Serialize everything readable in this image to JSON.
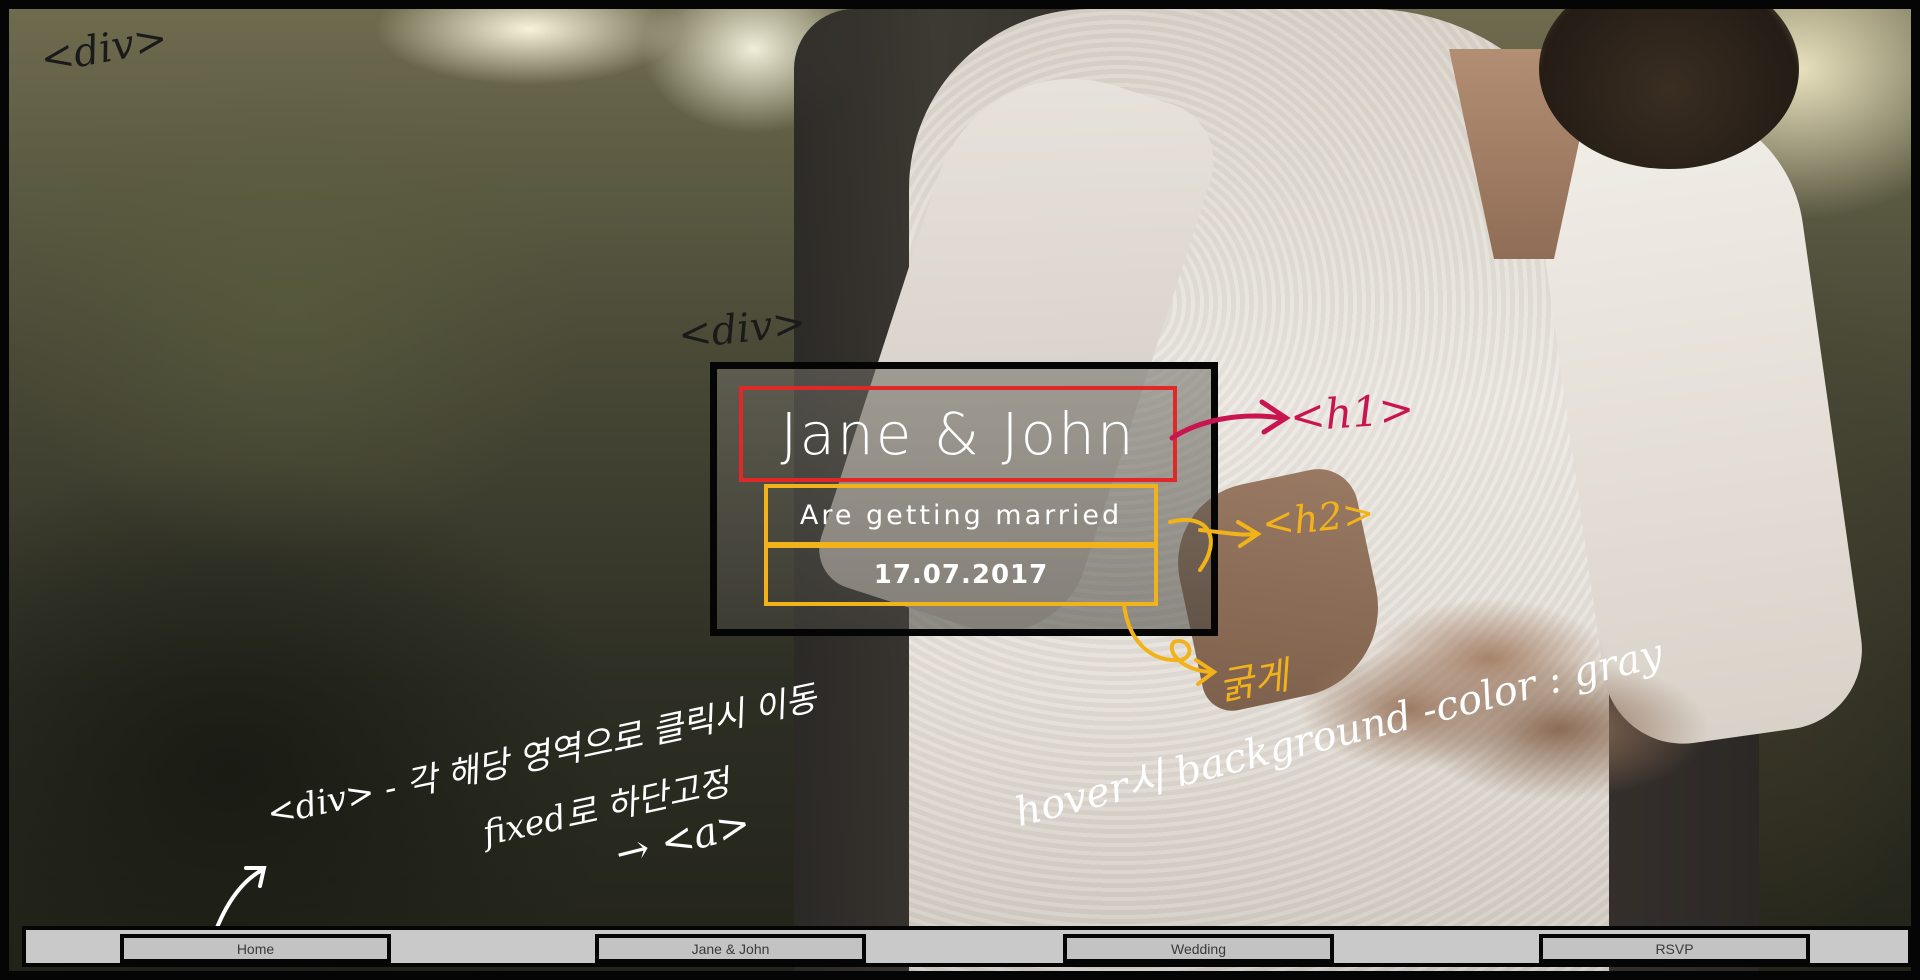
{
  "hero": {
    "title": "Jane & John",
    "subtitle": "Are getting married",
    "date": "17.07.2017"
  },
  "nav": {
    "items": [
      {
        "label": "Home"
      },
      {
        "label": "Jane & John"
      },
      {
        "label": "Wedding"
      },
      {
        "label": "RSVP"
      }
    ]
  },
  "annotations": {
    "div_top": "<div>",
    "div_center": "<div>",
    "h1_tag": "<h1>",
    "h2_tag": "<h2>",
    "bold_note": "굵게",
    "nav_note_line1": "<div> - 각 해당 영역으로 클릭시 이동",
    "nav_note_line2": "fixed로 하단고정",
    "nav_note_line3": "→ <a>",
    "hover_note": "hover시 background -color : gray"
  },
  "colors": {
    "frame": "#050505",
    "h1_outline": "#e02828",
    "h2_outline": "#f2b31a",
    "h1_annotation": "#c8144f",
    "h2_annotation": "#f2b31a",
    "nav_background": "#c9c9c9"
  }
}
